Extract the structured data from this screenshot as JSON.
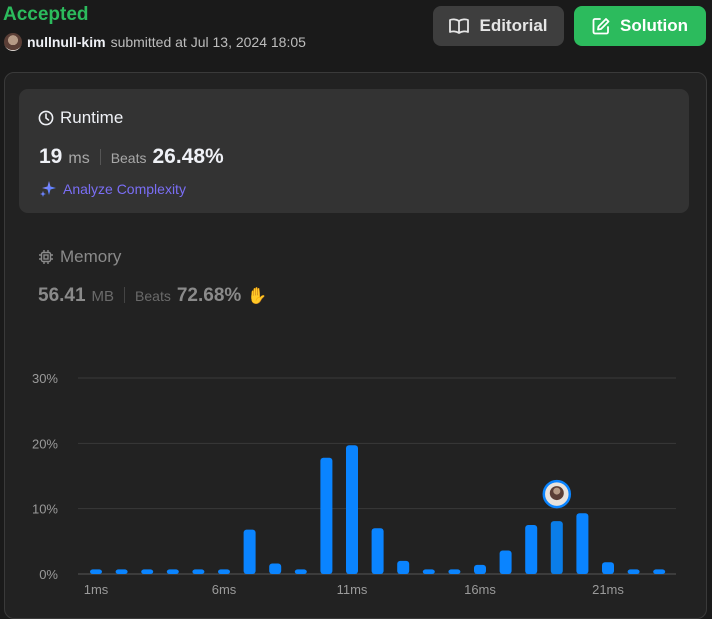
{
  "submission": {
    "status": "Accepted",
    "username": "nullnull-kim",
    "submitted_text": "submitted at Jul 13, 2024 18:05"
  },
  "buttons": {
    "editorial": "Editorial",
    "solution": "Solution",
    "editorial_icon": "book-icon",
    "solution_icon": "edit-icon"
  },
  "runtime": {
    "title": "Runtime",
    "value": "19",
    "unit": "ms",
    "beats_label": "Beats",
    "beats_pct": "26.48%",
    "analyze_label": "Analyze Complexity"
  },
  "memory": {
    "title": "Memory",
    "value": "56.41",
    "unit": "MB",
    "beats_label": "Beats",
    "beats_pct": "72.68%"
  },
  "colors": {
    "accent_green": "#2cbb5d",
    "bar_blue": "#0a84ff",
    "analyze_purple": "#7a6ef5"
  },
  "chart_data": {
    "type": "bar",
    "categories": [
      "1ms",
      "2ms",
      "3ms",
      "4ms",
      "5ms",
      "6ms",
      "7ms",
      "8ms",
      "9ms",
      "10ms",
      "11ms",
      "12ms",
      "13ms",
      "14ms",
      "15ms",
      "16ms",
      "17ms",
      "18ms",
      "19ms",
      "20ms",
      "21ms",
      "22ms",
      "23ms"
    ],
    "x_tick_labels": [
      "1ms",
      "6ms",
      "11ms",
      "16ms",
      "21ms"
    ],
    "values": [
      0.7,
      0.7,
      0.7,
      0.7,
      0.7,
      0.7,
      6.8,
      1.6,
      0.7,
      17.8,
      19.7,
      7.0,
      2.0,
      0.7,
      0.7,
      1.4,
      3.6,
      7.5,
      8.1,
      9.3,
      1.8,
      0.7,
      0.7
    ],
    "y_ticks": [
      "0%",
      "10%",
      "20%",
      "30%"
    ],
    "ylim": [
      0,
      30
    ],
    "highlight_category": "19ms",
    "grid": true
  }
}
